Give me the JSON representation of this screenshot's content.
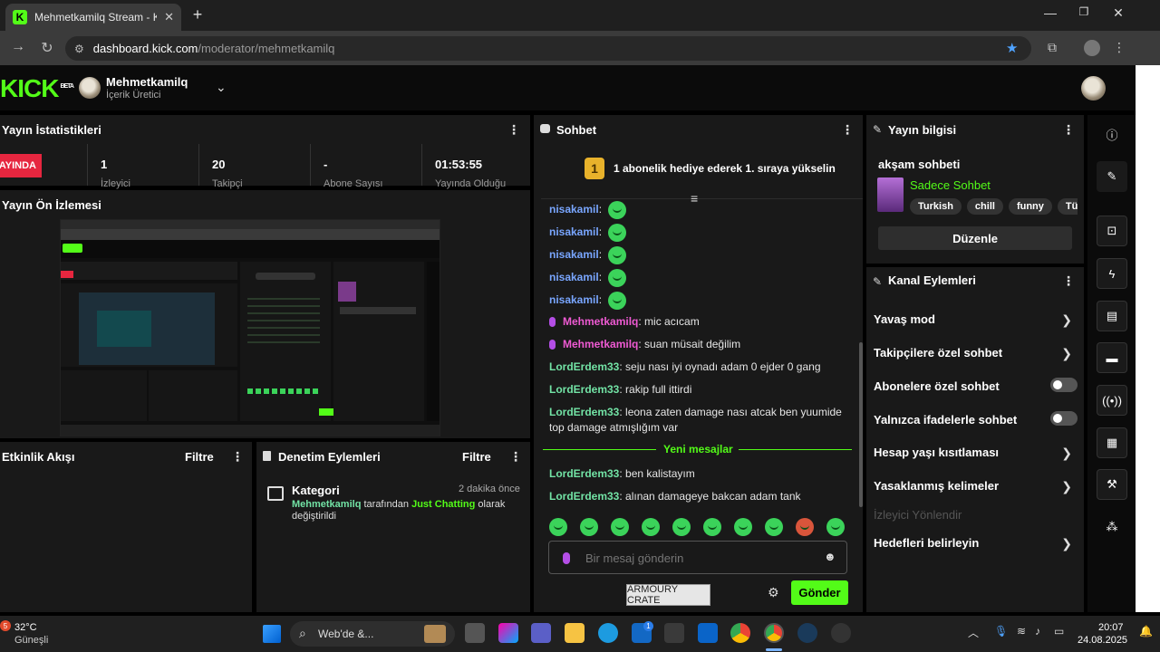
{
  "browser": {
    "tab_title": "Mehmetkamilq Stream - Kick D",
    "url_host": "dashboard.kick.com",
    "url_path": "/moderator/mehmetkamilq"
  },
  "header": {
    "logo": "KICK",
    "logo_badge": "BETA",
    "streamer_name": "Mehmetkamilq",
    "streamer_role": "İçerik Üretici"
  },
  "stats": {
    "title": "Yayın İstatistikleri",
    "live_badge": "YAYINDA",
    "items": [
      {
        "value": "1",
        "label": "İzleyici"
      },
      {
        "value": "20",
        "label": "Takipçi"
      },
      {
        "value": "-",
        "label": "Abone Sayısı"
      },
      {
        "value": "01:53:55",
        "label": "Yayında Olduğu"
      }
    ]
  },
  "preview": {
    "title": "Yayın Ön İzlemesi"
  },
  "activity": {
    "title": "Etkinlik Akışı",
    "filter": "Filtre"
  },
  "moderation": {
    "title": "Denetim Eylemleri",
    "filter": "Filtre",
    "entry": {
      "heading": "Kategori",
      "time": "2 dakika önce",
      "actor": "Mehmetkamilq",
      "middle": " tarafından ",
      "category": "Just Chatting",
      "suffix": " olarak değiştirildi"
    }
  },
  "chat": {
    "title": "Sohbet",
    "rank_number": "1",
    "banner": "1 abonelik hediye ederek 1. sıraya yükselin",
    "messages": [
      {
        "user": "nisakamil",
        "text": ""
      },
      {
        "user": "nisakamil",
        "text": ""
      },
      {
        "user": "nisakamil",
        "text": ""
      },
      {
        "user": "nisakamil",
        "text": ""
      },
      {
        "user": "nisakamil",
        "text": ""
      },
      {
        "user": "Mehmetkamilq",
        "text": "mic acıcam"
      },
      {
        "user": "Mehmetkamilq",
        "text": "suan müsait değilim"
      },
      {
        "user": "LordErdem33",
        "text": "seju nası iyi oynadı adam 0 ejder 0 gang"
      },
      {
        "user": "LordErdem33",
        "text": "rakip full ittirdi"
      },
      {
        "user": "LordErdem33",
        "text": "leona zaten damage nası atcak ben yuumide top damage atmışlığım var"
      },
      {
        "user": "LordErdem33",
        "text": "ben kalistayım"
      },
      {
        "user": "LordErdem33",
        "text": "alınan damageye bakcan adam tank"
      }
    ],
    "new_messages": "Yeni mesajlar",
    "input_placeholder": "Bir mesaj gönderin",
    "send": "Gönder",
    "tooltip": "ARMOURY CRATE"
  },
  "stream_info": {
    "title": "Yayın bilgisi",
    "stream_title": "akşam sohbeti",
    "category": "Sadece Sohbet",
    "tags": [
      "Turkish",
      "chill",
      "funny",
      "Türkçe"
    ],
    "edit": "Düzenle"
  },
  "channel_actions": {
    "title": "Kanal Eylemleri",
    "items": [
      {
        "label": "Yavaş mod"
      },
      {
        "label": "Takipçilere özel sohbet"
      },
      {
        "label": "Abonelere özel sohbet"
      },
      {
        "label": "Yalnızca ifadelerle sohbet"
      },
      {
        "label": "Hesap yaşı kısıtlaması"
      },
      {
        "label": "Yasaklanmış kelimeler"
      },
      {
        "label": "İzleyici Yönlendir"
      },
      {
        "label": "Hedefleri belirleyin"
      }
    ]
  },
  "taskbar": {
    "temp": "32°C",
    "weather": "Güneşli",
    "weather_badge": "5",
    "search": "Web'de &...",
    "time": "20:07",
    "date": "24.08.2025",
    "teams_badge": "1"
  },
  "colors": {
    "accent": "#53fc18",
    "live": "#e6263f"
  }
}
